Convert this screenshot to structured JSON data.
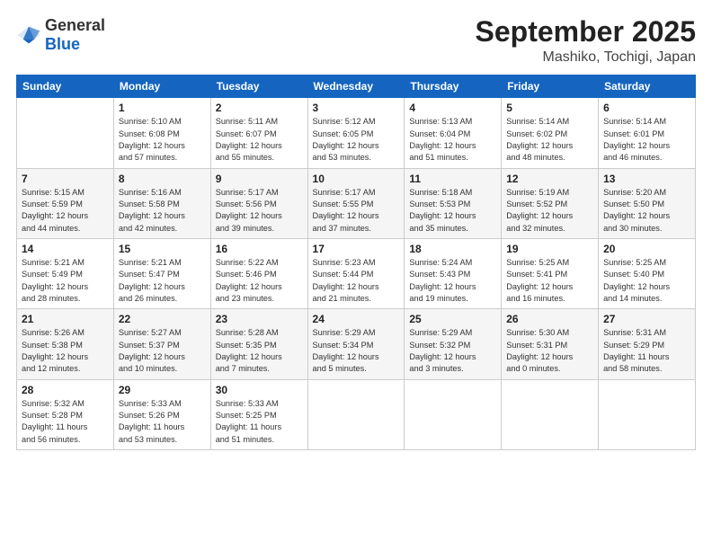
{
  "logo": {
    "general": "General",
    "blue": "Blue"
  },
  "header": {
    "month": "September 2025",
    "location": "Mashiko, Tochigi, Japan"
  },
  "weekdays": [
    "Sunday",
    "Monday",
    "Tuesday",
    "Wednesday",
    "Thursday",
    "Friday",
    "Saturday"
  ],
  "weeks": [
    [
      {
        "day": "",
        "info": ""
      },
      {
        "day": "1",
        "info": "Sunrise: 5:10 AM\nSunset: 6:08 PM\nDaylight: 12 hours\nand 57 minutes."
      },
      {
        "day": "2",
        "info": "Sunrise: 5:11 AM\nSunset: 6:07 PM\nDaylight: 12 hours\nand 55 minutes."
      },
      {
        "day": "3",
        "info": "Sunrise: 5:12 AM\nSunset: 6:05 PM\nDaylight: 12 hours\nand 53 minutes."
      },
      {
        "day": "4",
        "info": "Sunrise: 5:13 AM\nSunset: 6:04 PM\nDaylight: 12 hours\nand 51 minutes."
      },
      {
        "day": "5",
        "info": "Sunrise: 5:14 AM\nSunset: 6:02 PM\nDaylight: 12 hours\nand 48 minutes."
      },
      {
        "day": "6",
        "info": "Sunrise: 5:14 AM\nSunset: 6:01 PM\nDaylight: 12 hours\nand 46 minutes."
      }
    ],
    [
      {
        "day": "7",
        "info": "Sunrise: 5:15 AM\nSunset: 5:59 PM\nDaylight: 12 hours\nand 44 minutes."
      },
      {
        "day": "8",
        "info": "Sunrise: 5:16 AM\nSunset: 5:58 PM\nDaylight: 12 hours\nand 42 minutes."
      },
      {
        "day": "9",
        "info": "Sunrise: 5:17 AM\nSunset: 5:56 PM\nDaylight: 12 hours\nand 39 minutes."
      },
      {
        "day": "10",
        "info": "Sunrise: 5:17 AM\nSunset: 5:55 PM\nDaylight: 12 hours\nand 37 minutes."
      },
      {
        "day": "11",
        "info": "Sunrise: 5:18 AM\nSunset: 5:53 PM\nDaylight: 12 hours\nand 35 minutes."
      },
      {
        "day": "12",
        "info": "Sunrise: 5:19 AM\nSunset: 5:52 PM\nDaylight: 12 hours\nand 32 minutes."
      },
      {
        "day": "13",
        "info": "Sunrise: 5:20 AM\nSunset: 5:50 PM\nDaylight: 12 hours\nand 30 minutes."
      }
    ],
    [
      {
        "day": "14",
        "info": "Sunrise: 5:21 AM\nSunset: 5:49 PM\nDaylight: 12 hours\nand 28 minutes."
      },
      {
        "day": "15",
        "info": "Sunrise: 5:21 AM\nSunset: 5:47 PM\nDaylight: 12 hours\nand 26 minutes."
      },
      {
        "day": "16",
        "info": "Sunrise: 5:22 AM\nSunset: 5:46 PM\nDaylight: 12 hours\nand 23 minutes."
      },
      {
        "day": "17",
        "info": "Sunrise: 5:23 AM\nSunset: 5:44 PM\nDaylight: 12 hours\nand 21 minutes."
      },
      {
        "day": "18",
        "info": "Sunrise: 5:24 AM\nSunset: 5:43 PM\nDaylight: 12 hours\nand 19 minutes."
      },
      {
        "day": "19",
        "info": "Sunrise: 5:25 AM\nSunset: 5:41 PM\nDaylight: 12 hours\nand 16 minutes."
      },
      {
        "day": "20",
        "info": "Sunrise: 5:25 AM\nSunset: 5:40 PM\nDaylight: 12 hours\nand 14 minutes."
      }
    ],
    [
      {
        "day": "21",
        "info": "Sunrise: 5:26 AM\nSunset: 5:38 PM\nDaylight: 12 hours\nand 12 minutes."
      },
      {
        "day": "22",
        "info": "Sunrise: 5:27 AM\nSunset: 5:37 PM\nDaylight: 12 hours\nand 10 minutes."
      },
      {
        "day": "23",
        "info": "Sunrise: 5:28 AM\nSunset: 5:35 PM\nDaylight: 12 hours\nand 7 minutes."
      },
      {
        "day": "24",
        "info": "Sunrise: 5:29 AM\nSunset: 5:34 PM\nDaylight: 12 hours\nand 5 minutes."
      },
      {
        "day": "25",
        "info": "Sunrise: 5:29 AM\nSunset: 5:32 PM\nDaylight: 12 hours\nand 3 minutes."
      },
      {
        "day": "26",
        "info": "Sunrise: 5:30 AM\nSunset: 5:31 PM\nDaylight: 12 hours\nand 0 minutes."
      },
      {
        "day": "27",
        "info": "Sunrise: 5:31 AM\nSunset: 5:29 PM\nDaylight: 11 hours\nand 58 minutes."
      }
    ],
    [
      {
        "day": "28",
        "info": "Sunrise: 5:32 AM\nSunset: 5:28 PM\nDaylight: 11 hours\nand 56 minutes."
      },
      {
        "day": "29",
        "info": "Sunrise: 5:33 AM\nSunset: 5:26 PM\nDaylight: 11 hours\nand 53 minutes."
      },
      {
        "day": "30",
        "info": "Sunrise: 5:33 AM\nSunset: 5:25 PM\nDaylight: 11 hours\nand 51 minutes."
      },
      {
        "day": "",
        "info": ""
      },
      {
        "day": "",
        "info": ""
      },
      {
        "day": "",
        "info": ""
      },
      {
        "day": "",
        "info": ""
      }
    ]
  ]
}
